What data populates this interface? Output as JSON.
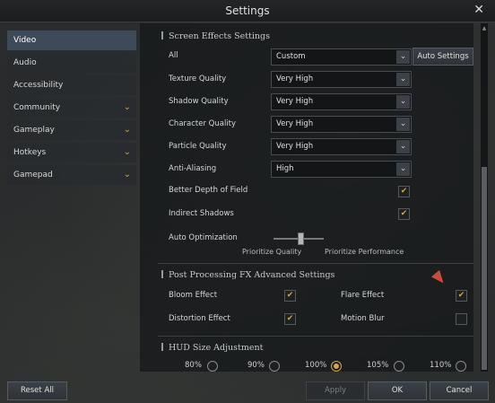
{
  "window": {
    "title": "Settings"
  },
  "sidebar": {
    "items": [
      {
        "label": "Video",
        "chevron": false,
        "active": true
      },
      {
        "label": "Audio",
        "chevron": false
      },
      {
        "label": "Accessibility",
        "chevron": false
      },
      {
        "label": "Community",
        "chevron": true
      },
      {
        "label": "Gameplay",
        "chevron": true
      },
      {
        "label": "Hotkeys",
        "chevron": true
      },
      {
        "label": "Gamepad",
        "chevron": true
      }
    ],
    "chevron_glyph": "⌄"
  },
  "screen_effects": {
    "title": "Screen Effects Settings",
    "all_label": "All",
    "all_value": "Custom",
    "auto_settings_label": "Auto Settings",
    "texture_label": "Texture Quality",
    "texture_value": "Very High",
    "shadow_label": "Shadow Quality",
    "shadow_value": "Very High",
    "character_label": "Character Quality",
    "character_value": "Very High",
    "particle_label": "Particle Quality",
    "particle_value": "Very High",
    "aa_label": "Anti-Aliasing",
    "aa_value": "High",
    "dof_label": "Better Depth of Field",
    "dof_checked": true,
    "indirect_label": "Indirect Shadows",
    "indirect_checked": true,
    "auto_opt_label": "Auto Optimization",
    "prioritize_quality": "Prioritize Quality",
    "prioritize_performance": "Prioritize Performance",
    "auto_opt_value": 0.5
  },
  "post_processing": {
    "title": "Post Processing FX Advanced Settings",
    "bloom_label": "Bloom Effect",
    "bloom_checked": true,
    "flare_label": "Flare Effect",
    "flare_checked": true,
    "distortion_label": "Distortion Effect",
    "distortion_checked": true,
    "motion_label": "Motion Blur",
    "motion_checked": false
  },
  "hud": {
    "title": "HUD Size Adjustment",
    "options": [
      {
        "label": "80%",
        "selected": false
      },
      {
        "label": "90%",
        "selected": false
      },
      {
        "label": "100%",
        "selected": true
      },
      {
        "label": "105%",
        "selected": false
      },
      {
        "label": "110%",
        "selected": false
      }
    ]
  },
  "footer": {
    "reset_label": "Reset All",
    "apply_label": "Apply",
    "ok_label": "OK",
    "cancel_label": "Cancel"
  },
  "icons": {
    "close": "✕",
    "dropdown": "⌄",
    "check": "✔"
  },
  "colors": {
    "accent": "#d4a44a",
    "active_tab": "#3d4a5a"
  }
}
